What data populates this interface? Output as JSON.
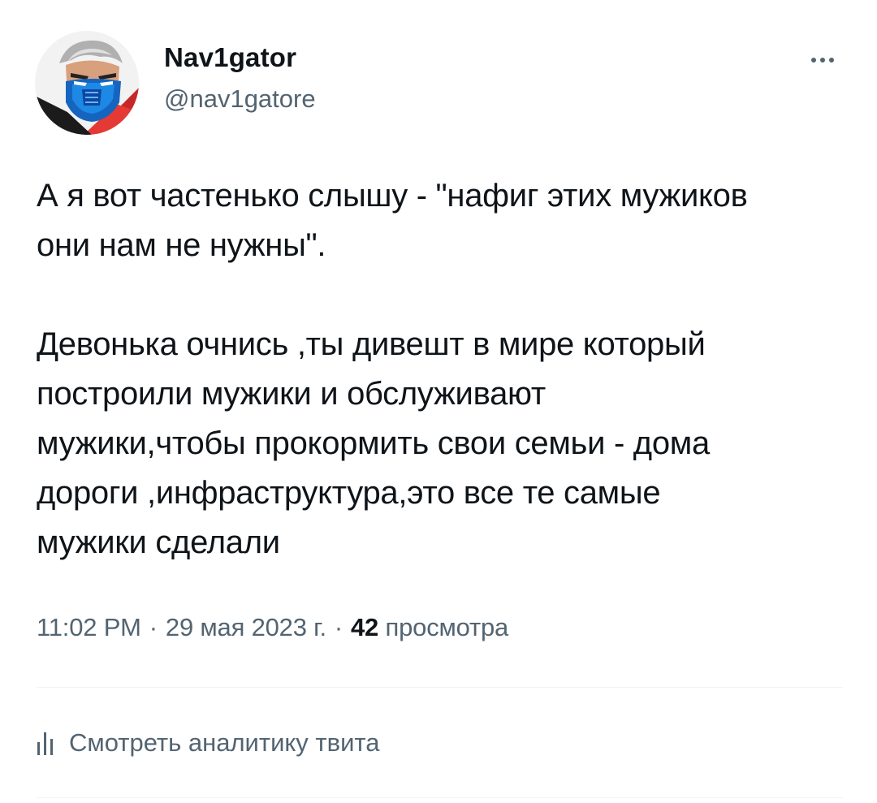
{
  "author": {
    "display_name": "Nav1gator",
    "handle": "@nav1gatore",
    "avatar_icon": "masked-hero-avatar"
  },
  "more_icon": "more-horizontal-icon",
  "tweet": {
    "lines_paragraph_1": [
      "А я вот частенько слышу - \"нафиг этих мужиков",
      "они нам не нужны\"."
    ],
    "lines_paragraph_2": [
      "Девонька очнись ,ты дивешт в мире который",
      "построили мужики и обслуживают",
      "мужики,чтобы прокормить свои семьи - дома",
      "дороги ,инфраструктура,это все те самые",
      "мужики сделали"
    ]
  },
  "meta": {
    "time": "11:02 PM",
    "separator": "·",
    "date": "29 мая 2023 г.",
    "views_count": "42",
    "views_label": "просмотра"
  },
  "analytics": {
    "icon": "bar-chart-icon",
    "label": "Смотреть аналитику твита"
  },
  "colors": {
    "text_primary": "#0f1419",
    "text_secondary": "#536471",
    "divider": "#eff3f4",
    "background": "#ffffff"
  }
}
